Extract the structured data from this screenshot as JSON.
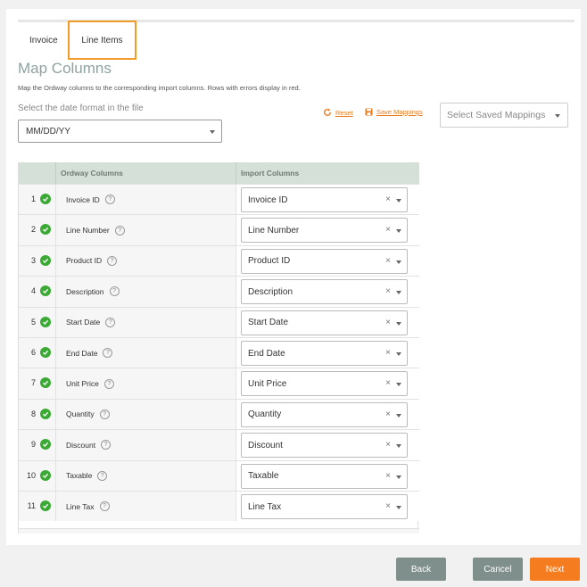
{
  "tabs": [
    {
      "label": "Invoice",
      "active": false
    },
    {
      "label": "Line Items",
      "active": true
    }
  ],
  "page": {
    "title": "Map Columns",
    "description": "Map the Ordway columns to the corresponding import columns. Rows with errors display in red."
  },
  "date_format": {
    "label": "Select the date format in the file",
    "value": "MM/DD/YY"
  },
  "actions": {
    "reset_label": "Reset",
    "save_mappings_label": "Save Mappings",
    "saved_mappings_placeholder": "Select Saved Mappings"
  },
  "table": {
    "headers": {
      "ordway": "Ordway Columns",
      "import": "Import Columns"
    },
    "rows": [
      {
        "num": "1",
        "ordway": "Invoice ID",
        "import": "Invoice ID"
      },
      {
        "num": "2",
        "ordway": "Line Number",
        "import": "Line Number"
      },
      {
        "num": "3",
        "ordway": "Product ID",
        "import": "Product ID"
      },
      {
        "num": "4",
        "ordway": "Description",
        "import": "Description"
      },
      {
        "num": "5",
        "ordway": "Start Date",
        "import": "Start Date"
      },
      {
        "num": "6",
        "ordway": "End Date",
        "import": "End Date"
      },
      {
        "num": "7",
        "ordway": "Unit Price",
        "import": "Unit Price"
      },
      {
        "num": "8",
        "ordway": "Quantity",
        "import": "Quantity"
      },
      {
        "num": "9",
        "ordway": "Discount",
        "import": "Discount"
      },
      {
        "num": "10",
        "ordway": "Taxable",
        "import": "Taxable"
      },
      {
        "num": "11",
        "ordway": "Line Tax",
        "import": "Line Tax"
      }
    ]
  },
  "footer": {
    "back_label": "Back",
    "cancel_label": "Cancel",
    "next_label": "Next"
  },
  "colors": {
    "accent": "#f57c1f",
    "tab_border": "#f29b28",
    "header_bg": "#d5e0d8",
    "check_green": "#3aaa35",
    "secondary_button": "#7f8f8b"
  },
  "icons": {
    "check": "check-circle-icon",
    "help": "question-circle-icon",
    "reset": "refresh-icon",
    "save": "save-icon",
    "clear": "close-icon",
    "dropdown": "caret-down-icon"
  }
}
